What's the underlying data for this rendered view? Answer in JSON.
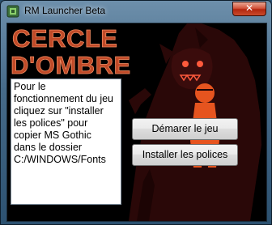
{
  "window": {
    "title": "RM Launcher Beta",
    "close_glyph": "✕"
  },
  "banner": {
    "line1": "CERCLE",
    "line2": "D'OMBRE"
  },
  "info": {
    "text": "Pour le\nfonctionnement du jeu\ncliquez sur \"installer\nles polices\" pour\ncopier MS Gothic\ndans le dossier\nC:/WINDOWS/Fonts"
  },
  "buttons": {
    "start_label": "Démarer le jeu",
    "install_fonts_label": "Installer les polices"
  },
  "colors": {
    "title_text": "#c04a28",
    "background": "#000000",
    "shadow_figure": "#2a0808",
    "eye_accent": "#ff5a3c"
  }
}
